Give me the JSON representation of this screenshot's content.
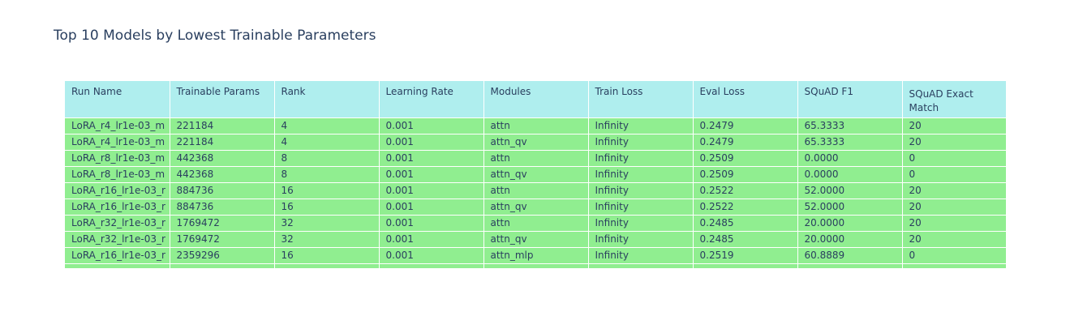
{
  "chart_data": {
    "type": "table",
    "title": "Top 10 Models by Lowest Trainable Parameters",
    "columns": [
      "Run Name",
      "Trainable Params",
      "Rank",
      "Learning Rate",
      "Modules",
      "Train Loss",
      "Eval Loss",
      "SQuAD F1",
      "SQuAD Exact Match"
    ],
    "rows": [
      [
        "LoRA_r4_lr1e-03_m",
        "221184",
        "4",
        "0.001",
        "attn",
        "Infinity",
        "0.2479",
        "65.3333",
        "20"
      ],
      [
        "LoRA_r4_lr1e-03_m",
        "221184",
        "4",
        "0.001",
        "attn_qv",
        "Infinity",
        "0.2479",
        "65.3333",
        "20"
      ],
      [
        "LoRA_r8_lr1e-03_m",
        "442368",
        "8",
        "0.001",
        "attn",
        "Infinity",
        "0.2509",
        "0.0000",
        "0"
      ],
      [
        "LoRA_r8_lr1e-03_m",
        "442368",
        "8",
        "0.001",
        "attn_qv",
        "Infinity",
        "0.2509",
        "0.0000",
        "0"
      ],
      [
        "LoRA_r16_lr1e-03_r",
        "884736",
        "16",
        "0.001",
        "attn",
        "Infinity",
        "0.2522",
        "52.0000",
        "20"
      ],
      [
        "LoRA_r16_lr1e-03_r",
        "884736",
        "16",
        "0.001",
        "attn_qv",
        "Infinity",
        "0.2522",
        "52.0000",
        "20"
      ],
      [
        "LoRA_r32_lr1e-03_r",
        "1769472",
        "32",
        "0.001",
        "attn",
        "Infinity",
        "0.2485",
        "20.0000",
        "20"
      ],
      [
        "LoRA_r32_lr1e-03_r",
        "1769472",
        "32",
        "0.001",
        "attn_qv",
        "Infinity",
        "0.2485",
        "20.0000",
        "20"
      ],
      [
        "LoRA_r16_lr1e-03_r",
        "2359296",
        "16",
        "0.001",
        "attn_mlp",
        "Infinity",
        "0.2519",
        "60.8889",
        "0"
      ],
      [
        "",
        "",
        "",
        "",
        "",
        "",
        "",
        "",
        ""
      ]
    ],
    "header_color": "#afeeee",
    "cell_color": "#90ee90"
  }
}
